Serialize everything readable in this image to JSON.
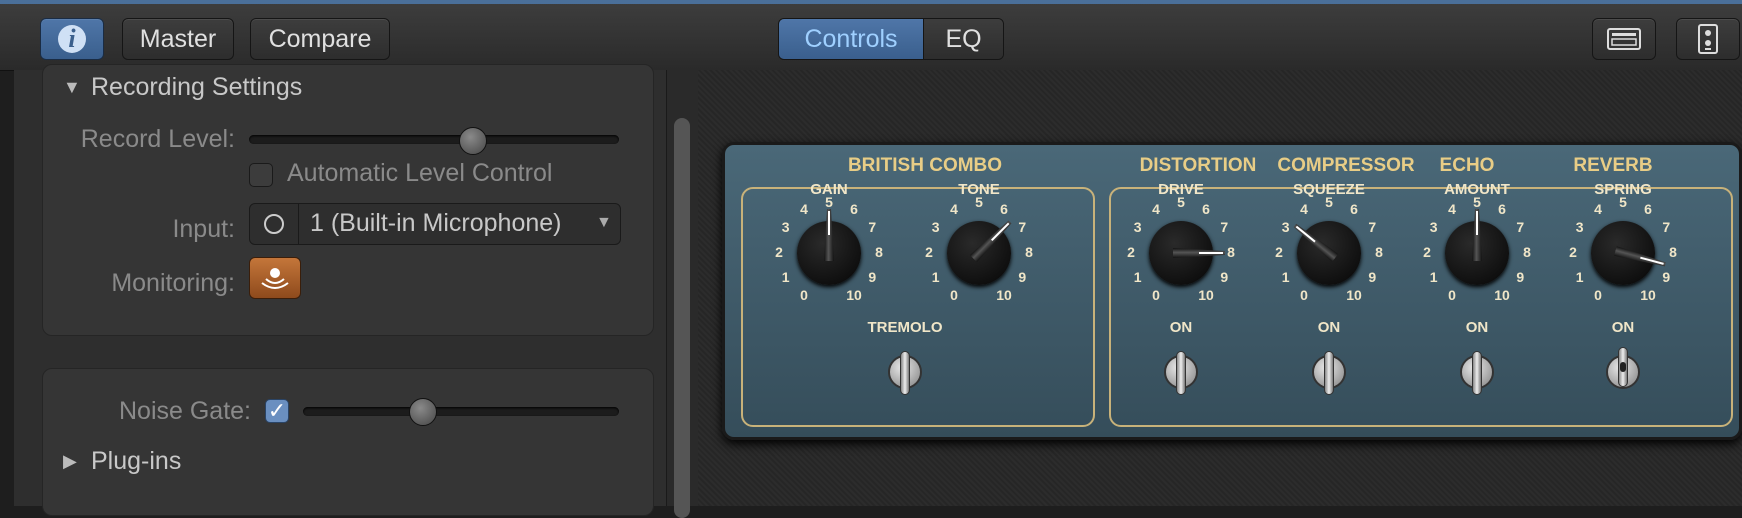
{
  "toolbar": {
    "info_icon": "info-icon",
    "master_label": "Master",
    "compare_label": "Compare",
    "view_tabs": [
      {
        "label": "Controls",
        "selected": true
      },
      {
        "label": "EQ",
        "selected": false
      }
    ],
    "right_icons": [
      "keyboard-icon",
      "stompbox-icon"
    ]
  },
  "recording_settings": {
    "title": "Recording Settings",
    "record_level_label": "Record Level:",
    "record_level_value": 0.6,
    "auto_level_label": "Automatic Level Control",
    "auto_level_checked": false,
    "input_label": "Input:",
    "input_value": "1  (Built-in Microphone)",
    "monitoring_label": "Monitoring:",
    "monitoring_on": true
  },
  "gate": {
    "noise_gate_label": "Noise Gate:",
    "noise_gate_checked": true,
    "noise_gate_value": 0.36,
    "plugins_label": "Plug-ins"
  },
  "amp": {
    "british_combo_title": "BRITISH COMBO",
    "sections": [
      "DISTORTION",
      "COMPRESSOR",
      "ECHO",
      "REVERB"
    ],
    "knobs": [
      {
        "label": "GAIN",
        "value": 5
      },
      {
        "label": "TONE",
        "value": 6.5
      },
      {
        "label": "DRIVE",
        "value": 8
      },
      {
        "label": "SQUEEZE",
        "value": 3.3
      },
      {
        "label": "AMOUNT",
        "value": 5
      },
      {
        "label": "SPRING",
        "value": 8.5
      }
    ],
    "scale": [
      "0",
      "1",
      "2",
      "3",
      "4",
      "5",
      "6",
      "7",
      "8",
      "9",
      "10"
    ],
    "switches": [
      {
        "label": "TREMOLO",
        "on": false
      },
      {
        "label": "ON",
        "on": false
      },
      {
        "label": "ON",
        "on": false
      },
      {
        "label": "ON",
        "on": false
      },
      {
        "label": "ON",
        "on": true
      }
    ],
    "colors": {
      "panel": "#4a6878",
      "trim": "#c8b27a",
      "title": "#e8cd86"
    }
  }
}
